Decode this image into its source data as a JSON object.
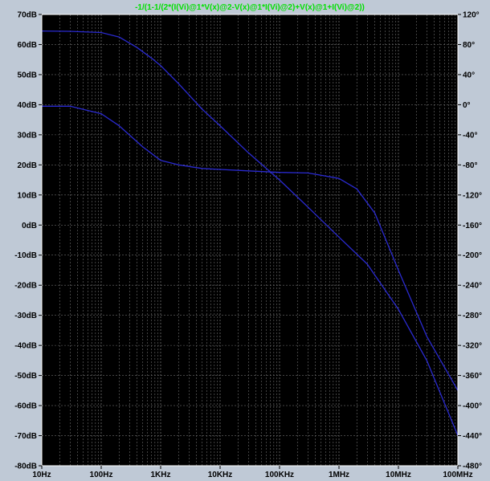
{
  "window": {
    "background_color": "#bfc9d6"
  },
  "chart_data": {
    "type": "line",
    "title": "-1/(1-1/(2*(I(Vi)@1*V(x)@2-V(x)@1*I(Vi)@2)+V(x)@1+I(Vi)@2))",
    "title_color": "#00e000",
    "background_color": "#000000",
    "grid": true,
    "grid_color": "#6e6e6e",
    "x_axis": {
      "scale": "log",
      "range": [
        10,
        100000000
      ],
      "unit": "Hz",
      "ticks": [
        {
          "value": 10,
          "label": "10Hz"
        },
        {
          "value": 100,
          "label": "100Hz"
        },
        {
          "value": 1000,
          "label": "1KHz"
        },
        {
          "value": 10000,
          "label": "10KHz"
        },
        {
          "value": 100000,
          "label": "100KHz"
        },
        {
          "value": 1000000,
          "label": "1MHz"
        },
        {
          "value": 10000000,
          "label": "10MHz"
        },
        {
          "value": 100000000,
          "label": "100MHz"
        }
      ]
    },
    "y_left_axis": {
      "range": [
        -80,
        70
      ],
      "unit": "dB",
      "ticks": [
        {
          "value": 70,
          "label": "70dB"
        },
        {
          "value": 60,
          "label": "60dB"
        },
        {
          "value": 50,
          "label": "50dB"
        },
        {
          "value": 40,
          "label": "40dB"
        },
        {
          "value": 30,
          "label": "30dB"
        },
        {
          "value": 20,
          "label": "20dB"
        },
        {
          "value": 10,
          "label": "10dB"
        },
        {
          "value": 0,
          "label": "0dB"
        },
        {
          "value": -10,
          "label": "-10dB"
        },
        {
          "value": -20,
          "label": "-20dB"
        },
        {
          "value": -30,
          "label": "-30dB"
        },
        {
          "value": -40,
          "label": "-40dB"
        },
        {
          "value": -50,
          "label": "-50dB"
        },
        {
          "value": -60,
          "label": "-60dB"
        },
        {
          "value": -70,
          "label": "-70dB"
        },
        {
          "value": -80,
          "label": "-80dB"
        }
      ]
    },
    "y_right_axis": {
      "range": [
        -480,
        120
      ],
      "unit": "°",
      "ticks": [
        {
          "value": 120,
          "label": "120°"
        },
        {
          "value": 80,
          "label": "80°"
        },
        {
          "value": 40,
          "label": "40°"
        },
        {
          "value": 0,
          "label": "0°"
        },
        {
          "value": -40,
          "label": "-40°"
        },
        {
          "value": -80,
          "label": "-80°"
        },
        {
          "value": -120,
          "label": "-120°"
        },
        {
          "value": -160,
          "label": "-160°"
        },
        {
          "value": -200,
          "label": "-200°"
        },
        {
          "value": -240,
          "label": "-240°"
        },
        {
          "value": -280,
          "label": "-280°"
        },
        {
          "value": -320,
          "label": "-320°"
        },
        {
          "value": -360,
          "label": "-360°"
        },
        {
          "value": -400,
          "label": "-400°"
        },
        {
          "value": -440,
          "label": "-440°"
        },
        {
          "value": -480,
          "label": "-480°"
        }
      ]
    },
    "series": [
      {
        "axis": "left",
        "color": "#2a2ad0",
        "x": [
          10,
          30,
          100,
          200,
          400,
          700,
          1000,
          2000,
          5000,
          10000,
          30000,
          100000,
          300000,
          1000000,
          3000000,
          10000000,
          30000000,
          100000000
        ],
        "y": [
          64.5,
          64.4,
          64,
          62.5,
          59,
          55.5,
          53,
          47,
          38.5,
          33,
          24,
          15,
          6,
          -4,
          -13,
          -28,
          -45,
          -70
        ]
      },
      {
        "axis": "left",
        "color": "#2a2ad0",
        "x": [
          10,
          30,
          100,
          200,
          500,
          1000,
          2000,
          5000,
          10000,
          30000,
          100000,
          300000,
          1000000,
          2000000,
          4000000,
          10000000,
          30000000,
          100000000
        ],
        "y": [
          39.5,
          39.5,
          37,
          33,
          26,
          21.5,
          20,
          18.8,
          18.5,
          18,
          17.5,
          17.3,
          15.5,
          12,
          4,
          -15,
          -37,
          -55
        ]
      }
    ]
  }
}
